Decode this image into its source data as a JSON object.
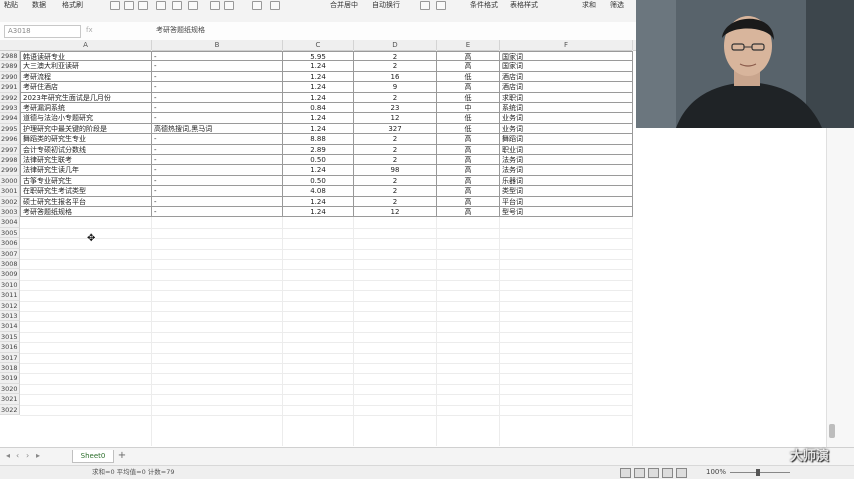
{
  "toolbar": {
    "items": [
      "粘贴",
      "数据",
      "格式刷",
      "合并居中",
      "自动换行",
      "条件格式",
      "表格样式",
      "求和",
      "筛选"
    ]
  },
  "formula_bar": {
    "name_box": "A3018",
    "fx_label": "fx",
    "content": "考研答题纸规格"
  },
  "columns": [
    "A",
    "B",
    "C",
    "D",
    "E",
    "F"
  ],
  "rows": [
    {
      "num": "2988",
      "a": "韩语读研专业",
      "b": "-",
      "c": "5.95",
      "d": "2",
      "e": "高",
      "f": "国家词"
    },
    {
      "num": "2989",
      "a": "大三澳大利亚读研",
      "b": "-",
      "c": "1.24",
      "d": "2",
      "e": "高",
      "f": "国家词"
    },
    {
      "num": "2990",
      "a": "考研流程",
      "b": "-",
      "c": "1.24",
      "d": "16",
      "e": "低",
      "f": "酒店词"
    },
    {
      "num": "2991",
      "a": "考研住酒店",
      "b": "-",
      "c": "1.24",
      "d": "9",
      "e": "高",
      "f": "酒店词"
    },
    {
      "num": "2992",
      "a": "2023年研究生面试是几月份",
      "b": "-",
      "c": "1.24",
      "d": "2",
      "e": "低",
      "f": "求职词"
    },
    {
      "num": "2993",
      "a": "考研漏洞系统",
      "b": "-",
      "c": "0.84",
      "d": "23",
      "e": "中",
      "f": "系统词"
    },
    {
      "num": "2994",
      "a": "道德与法治小专题研究",
      "b": "-",
      "c": "1.24",
      "d": "12",
      "e": "低",
      "f": "业务词"
    },
    {
      "num": "2995",
      "a": "护理研究中最关键的阶段是",
      "b": "高德热搜词,黑马词",
      "c": "1.24",
      "d": "327",
      "e": "低",
      "f": "业务词"
    },
    {
      "num": "2996",
      "a": "舞蹈类的研究生专业",
      "b": "-",
      "c": "8.88",
      "d": "2",
      "e": "高",
      "f": "舞蹈词"
    },
    {
      "num": "2997",
      "a": "会计专硕初试分数线",
      "b": "-",
      "c": "2.89",
      "d": "2",
      "e": "高",
      "f": "职业词"
    },
    {
      "num": "2998",
      "a": "法律研究生联考",
      "b": "-",
      "c": "0.50",
      "d": "2",
      "e": "高",
      "f": "法务词"
    },
    {
      "num": "2999",
      "a": "法律研究生读几年",
      "b": "-",
      "c": "1.24",
      "d": "98",
      "e": "高",
      "f": "法务词"
    },
    {
      "num": "3000",
      "a": "古筝专业研究生",
      "b": "-",
      "c": "0.50",
      "d": "2",
      "e": "高",
      "f": "乐器词"
    },
    {
      "num": "3001",
      "a": "在职研究生考试类型",
      "b": "-",
      "c": "4.08",
      "d": "2",
      "e": "高",
      "f": "类型词"
    },
    {
      "num": "3002",
      "a": "硕士研究生报名平台",
      "b": "-",
      "c": "1.24",
      "d": "2",
      "e": "高",
      "f": "平台词"
    },
    {
      "num": "3003",
      "a": "考研答题纸规格",
      "b": "-",
      "c": "1.24",
      "d": "12",
      "e": "高",
      "f": "型号词"
    }
  ],
  "empty_rows": [
    "3004",
    "3005",
    "3006",
    "3007",
    "3008",
    "3009",
    "3010",
    "3011",
    "3012",
    "3013",
    "3014",
    "3015",
    "3016",
    "3017",
    "3018",
    "3019",
    "3020",
    "3021",
    "3022"
  ],
  "sheet_tabs": {
    "active": "Sheet0",
    "add": "+"
  },
  "status_bar": {
    "text": "求和=0  平均值=0  计数=79",
    "zoom": "100%"
  },
  "watermark": "大师演",
  "colors": {
    "grid_border": "#9a9a9a",
    "header_bg": "#efefef",
    "tab_text": "#2b6e2b"
  }
}
